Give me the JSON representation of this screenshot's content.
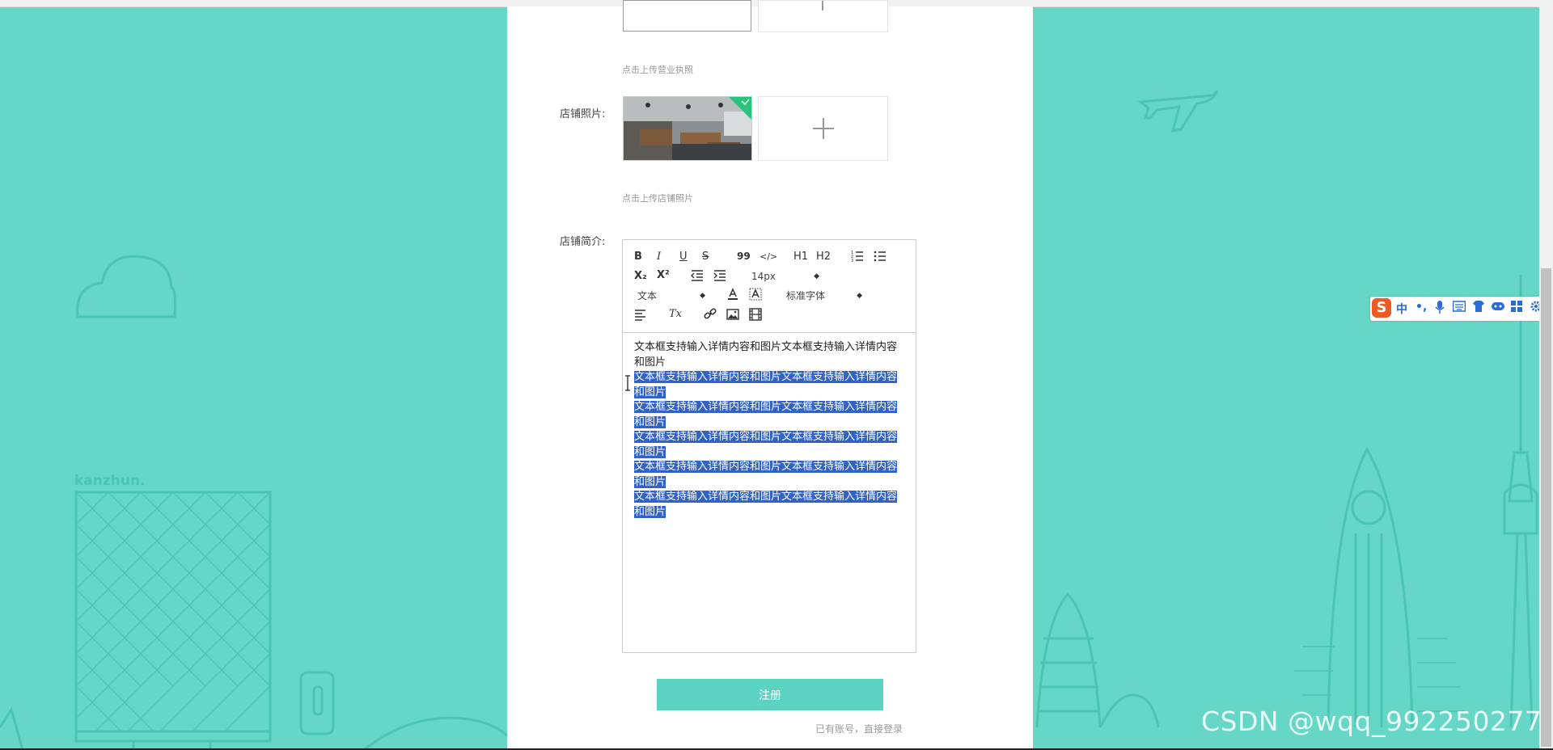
{
  "form": {
    "license_hint": "点击上传营业执照",
    "shop_photo_label": "店铺照片:",
    "shop_photo_hint": "点击上传店铺照片",
    "shop_intro_label": "店铺简介:"
  },
  "editor": {
    "toolbar": {
      "bold": "B",
      "italic": "I",
      "underline": "U",
      "strike": "S",
      "quote": "99",
      "code": "</>",
      "h1": "H1",
      "h2": "H2",
      "subscript": "X₂",
      "superscript": "X²",
      "font_size": "14px",
      "block_type": "文本",
      "font_family": "标准字体",
      "clear_format": "Tx"
    },
    "paragraphs": [
      {
        "line1": "文本框支持输入详情内容和图片文本框支持输入详情内容",
        "line2": "和图片"
      },
      {
        "line1": "文本框支持输入详情内容和图片文本框支持输入详情内容",
        "line2": "和图片"
      },
      {
        "line1": "文本框支持输入详情内容和图片文本框支持输入详情内容",
        "line2": "和图片"
      },
      {
        "line1": "文本框支持输入详情内容和图片文本框支持输入详情内容",
        "line2": "和图片"
      },
      {
        "line1": "文本框支持输入详情内容和图片文本框支持输入详情内容",
        "line2": "和图片"
      },
      {
        "line1": "文本框支持输入详情内容和图片文本框支持输入详情内容",
        "line2": "和图片"
      }
    ]
  },
  "submit_label": "注册",
  "login_link": "已有账号，直接登录",
  "background": {
    "brand_text": "kanzhun."
  },
  "ime": {
    "logo": "S",
    "mode": "中",
    "punct": "•,"
  },
  "watermark": "CSDN @wqq_992250277",
  "colors": {
    "background": "#66d6c6",
    "accent": "#5cd2c0",
    "selection": "#3162c7"
  }
}
